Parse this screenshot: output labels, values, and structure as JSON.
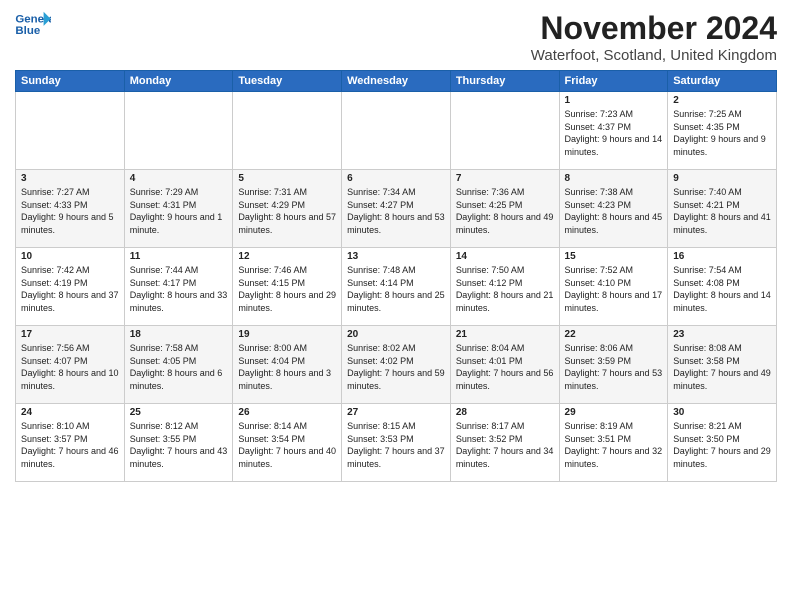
{
  "logo": {
    "line1": "General",
    "line2": "Blue"
  },
  "title": "November 2024",
  "subtitle": "Waterfoot, Scotland, United Kingdom",
  "days_of_week": [
    "Sunday",
    "Monday",
    "Tuesday",
    "Wednesday",
    "Thursday",
    "Friday",
    "Saturday"
  ],
  "weeks": [
    [
      {
        "day": "",
        "info": ""
      },
      {
        "day": "",
        "info": ""
      },
      {
        "day": "",
        "info": ""
      },
      {
        "day": "",
        "info": ""
      },
      {
        "day": "",
        "info": ""
      },
      {
        "day": "1",
        "info": "Sunrise: 7:23 AM\nSunset: 4:37 PM\nDaylight: 9 hours and 14 minutes."
      },
      {
        "day": "2",
        "info": "Sunrise: 7:25 AM\nSunset: 4:35 PM\nDaylight: 9 hours and 9 minutes."
      }
    ],
    [
      {
        "day": "3",
        "info": "Sunrise: 7:27 AM\nSunset: 4:33 PM\nDaylight: 9 hours and 5 minutes."
      },
      {
        "day": "4",
        "info": "Sunrise: 7:29 AM\nSunset: 4:31 PM\nDaylight: 9 hours and 1 minute."
      },
      {
        "day": "5",
        "info": "Sunrise: 7:31 AM\nSunset: 4:29 PM\nDaylight: 8 hours and 57 minutes."
      },
      {
        "day": "6",
        "info": "Sunrise: 7:34 AM\nSunset: 4:27 PM\nDaylight: 8 hours and 53 minutes."
      },
      {
        "day": "7",
        "info": "Sunrise: 7:36 AM\nSunset: 4:25 PM\nDaylight: 8 hours and 49 minutes."
      },
      {
        "day": "8",
        "info": "Sunrise: 7:38 AM\nSunset: 4:23 PM\nDaylight: 8 hours and 45 minutes."
      },
      {
        "day": "9",
        "info": "Sunrise: 7:40 AM\nSunset: 4:21 PM\nDaylight: 8 hours and 41 minutes."
      }
    ],
    [
      {
        "day": "10",
        "info": "Sunrise: 7:42 AM\nSunset: 4:19 PM\nDaylight: 8 hours and 37 minutes."
      },
      {
        "day": "11",
        "info": "Sunrise: 7:44 AM\nSunset: 4:17 PM\nDaylight: 8 hours and 33 minutes."
      },
      {
        "day": "12",
        "info": "Sunrise: 7:46 AM\nSunset: 4:15 PM\nDaylight: 8 hours and 29 minutes."
      },
      {
        "day": "13",
        "info": "Sunrise: 7:48 AM\nSunset: 4:14 PM\nDaylight: 8 hours and 25 minutes."
      },
      {
        "day": "14",
        "info": "Sunrise: 7:50 AM\nSunset: 4:12 PM\nDaylight: 8 hours and 21 minutes."
      },
      {
        "day": "15",
        "info": "Sunrise: 7:52 AM\nSunset: 4:10 PM\nDaylight: 8 hours and 17 minutes."
      },
      {
        "day": "16",
        "info": "Sunrise: 7:54 AM\nSunset: 4:08 PM\nDaylight: 8 hours and 14 minutes."
      }
    ],
    [
      {
        "day": "17",
        "info": "Sunrise: 7:56 AM\nSunset: 4:07 PM\nDaylight: 8 hours and 10 minutes."
      },
      {
        "day": "18",
        "info": "Sunrise: 7:58 AM\nSunset: 4:05 PM\nDaylight: 8 hours and 6 minutes."
      },
      {
        "day": "19",
        "info": "Sunrise: 8:00 AM\nSunset: 4:04 PM\nDaylight: 8 hours and 3 minutes."
      },
      {
        "day": "20",
        "info": "Sunrise: 8:02 AM\nSunset: 4:02 PM\nDaylight: 7 hours and 59 minutes."
      },
      {
        "day": "21",
        "info": "Sunrise: 8:04 AM\nSunset: 4:01 PM\nDaylight: 7 hours and 56 minutes."
      },
      {
        "day": "22",
        "info": "Sunrise: 8:06 AM\nSunset: 3:59 PM\nDaylight: 7 hours and 53 minutes."
      },
      {
        "day": "23",
        "info": "Sunrise: 8:08 AM\nSunset: 3:58 PM\nDaylight: 7 hours and 49 minutes."
      }
    ],
    [
      {
        "day": "24",
        "info": "Sunrise: 8:10 AM\nSunset: 3:57 PM\nDaylight: 7 hours and 46 minutes."
      },
      {
        "day": "25",
        "info": "Sunrise: 8:12 AM\nSunset: 3:55 PM\nDaylight: 7 hours and 43 minutes."
      },
      {
        "day": "26",
        "info": "Sunrise: 8:14 AM\nSunset: 3:54 PM\nDaylight: 7 hours and 40 minutes."
      },
      {
        "day": "27",
        "info": "Sunrise: 8:15 AM\nSunset: 3:53 PM\nDaylight: 7 hours and 37 minutes."
      },
      {
        "day": "28",
        "info": "Sunrise: 8:17 AM\nSunset: 3:52 PM\nDaylight: 7 hours and 34 minutes."
      },
      {
        "day": "29",
        "info": "Sunrise: 8:19 AM\nSunset: 3:51 PM\nDaylight: 7 hours and 32 minutes."
      },
      {
        "day": "30",
        "info": "Sunrise: 8:21 AM\nSunset: 3:50 PM\nDaylight: 7 hours and 29 minutes."
      }
    ]
  ]
}
